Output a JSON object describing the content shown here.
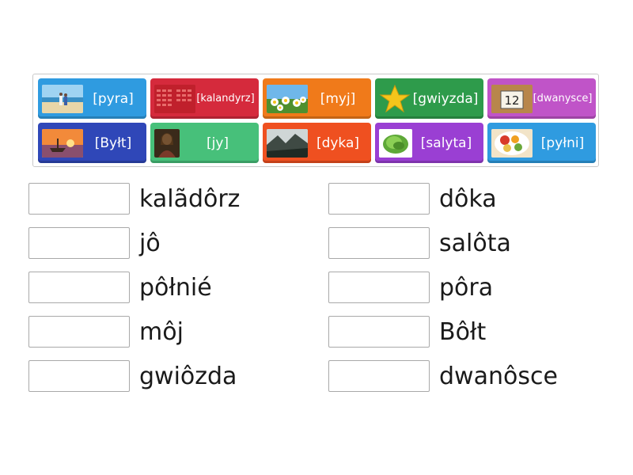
{
  "tiles": [
    {
      "label": "[pyra]",
      "color": "#2f9be0",
      "image": "beach-couple-image"
    },
    {
      "label": "[kalandyrz]",
      "color": "#d52a3c",
      "image": "calendar-image"
    },
    {
      "label": "[myj]",
      "color": "#f07a1a",
      "image": "daisies-image"
    },
    {
      "label": "[gwiyzda]",
      "color": "#2e9b4b",
      "image": "star-image"
    },
    {
      "label": "[dwanysce]",
      "color": "#c054c8",
      "image": "number-12-image"
    },
    {
      "label": "[Byłt]",
      "color": "#2f47b8",
      "image": "sunset-boat-image"
    },
    {
      "label": "[jy]",
      "color": "#47c07a",
      "image": "portrait-painting-image"
    },
    {
      "label": "[dyka]",
      "color": "#ef5020",
      "image": "misty-valley-image"
    },
    {
      "label": "[salyta]",
      "color": "#9a3fd3",
      "image": "lettuce-image"
    },
    {
      "label": "[pyłni]",
      "color": "#2f9be0",
      "image": "food-plate-image"
    }
  ],
  "targets": [
    {
      "word": "kalãdôrz"
    },
    {
      "word": "jô"
    },
    {
      "word": "pôłnié"
    },
    {
      "word": "môj"
    },
    {
      "word": "gwiôzda"
    },
    {
      "word": "dôka"
    },
    {
      "word": "salôta"
    },
    {
      "word": "pôra"
    },
    {
      "word": "Bôłt"
    },
    {
      "word": "dwanôsce"
    }
  ]
}
